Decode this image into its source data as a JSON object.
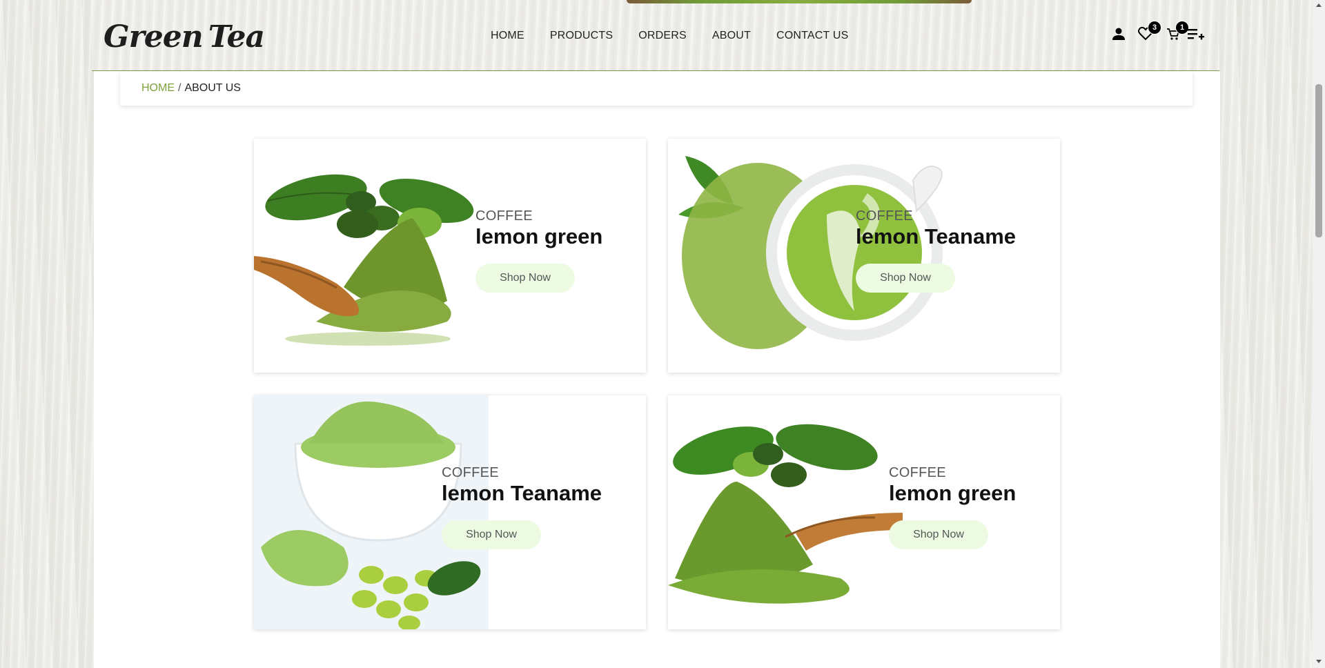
{
  "brand": {
    "word1": "Green",
    "word2": "Tea"
  },
  "nav": [
    {
      "label": "HOME"
    },
    {
      "label": "PRODUCTS"
    },
    {
      "label": "ORDERS"
    },
    {
      "label": "ABOUT"
    },
    {
      "label": "CONTACT US"
    }
  ],
  "header_icons": {
    "user": "user-icon",
    "wishlist": "heart-icon",
    "wishlist_count": "3",
    "cart": "cart-icon",
    "cart_count": "1",
    "menu": "playlist-add-icon"
  },
  "breadcrumb": {
    "home": "HOME",
    "separator": "/",
    "current": "ABOUT US"
  },
  "cards": [
    {
      "category": "COFFEE",
      "name": "lemon green",
      "button": "Shop Now",
      "image": "green-coffee-beans-powder-scoop"
    },
    {
      "category": "COFFEE",
      "name": "lemon Teaname",
      "button": "Shop Now",
      "image": "matcha-latte-cup"
    },
    {
      "category": "COFFEE",
      "name": "lemon Teaname",
      "button": "Shop Now",
      "image": "matcha-bowl-beans"
    },
    {
      "category": "COFFEE",
      "name": "lemon green",
      "button": "Shop Now",
      "image": "green-coffee-powder-scoop-right"
    }
  ],
  "colors": {
    "accent": "#7da13c",
    "button_bg": "#ecfbe2",
    "matcha": "#8cb83f"
  }
}
